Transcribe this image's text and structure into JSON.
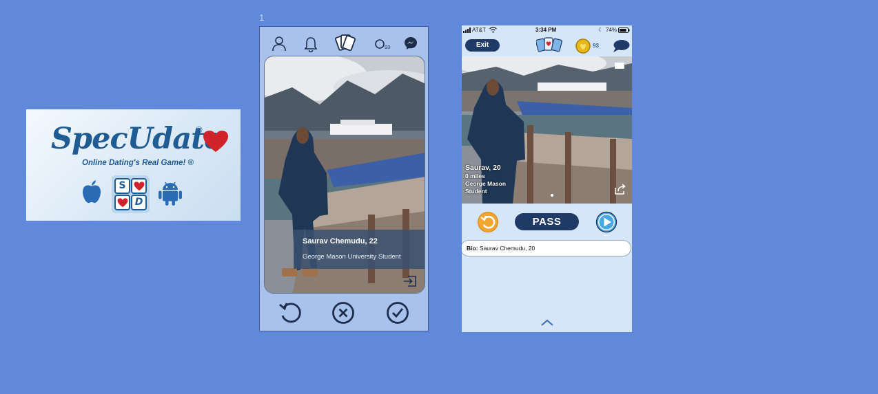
{
  "logo": {
    "wordmark": "SpecUdate",
    "registered": "®",
    "tagline": "Online Dating's Real Game! ®",
    "tile_letters": [
      "S",
      "D"
    ],
    "platform_icons": [
      "apple-icon",
      "android-icon"
    ]
  },
  "artboard": {
    "number": "1"
  },
  "phone1": {
    "nav_icons": [
      "profile-icon",
      "bell-icon",
      "cards-icon",
      "coins-icon",
      "messenger-icon"
    ],
    "coin_count": "93",
    "profile_name": "Saurav Chemudu, 22",
    "profile_school": "George Mason University Student",
    "actions": [
      "undo-icon",
      "reject-icon",
      "accept-icon"
    ]
  },
  "phone2": {
    "status": {
      "carrier": "AT&T",
      "time": "3:34 PM",
      "battery": "74%"
    },
    "exit_label": "Exit",
    "coin_count": "93",
    "profile": {
      "name_age": "Saurav, 20",
      "distance": "0 miles",
      "school_line1": "George Mason",
      "school_line2": "Student"
    },
    "pass_label": "PASS",
    "bio_label": "Bio:",
    "bio_text": "Saurav Chemudu, 20"
  },
  "colors": {
    "background": "#6088db",
    "navy": "#1f3a66",
    "brand_blue": "#1f5c94",
    "heart_red": "#d1232a",
    "phone1_bg": "#a8c2ec",
    "phone2_bg": "#d6e6f9"
  }
}
